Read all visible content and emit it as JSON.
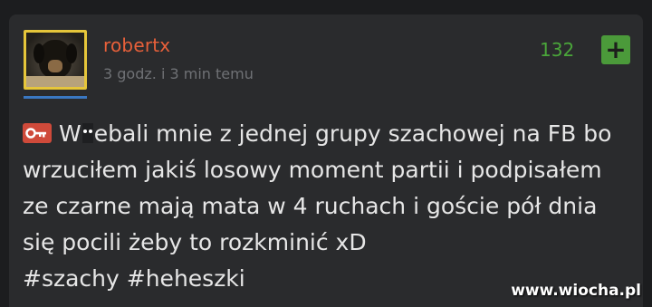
{
  "post": {
    "username": "robertx",
    "timestamp": "3 godz. i 3 min temu",
    "votes": "132",
    "plus_label": "+",
    "text_part1": "W",
    "text_part2": "ebali mnie z jednej grupy szachowej na FB bo wrzuciłem jakiś losowy moment partii i podpisałem ze czarne mają mata w 4 ruchach i goście pół dnia się pocili żeby to rozkminić xD",
    "hashtags": [
      "#szachy",
      "#heheszki"
    ],
    "badge_icon": "key-icon",
    "avatar_icon": "dog-avatar"
  },
  "watermark": "www.wiocha.pl",
  "colors": {
    "username": "#e8603a",
    "votes": "#4aa63a",
    "plus_button": "#4b9a3a",
    "badge": "#cf4a3a",
    "avatar_border": "#e6c63a",
    "background": "#2a2b2d"
  }
}
